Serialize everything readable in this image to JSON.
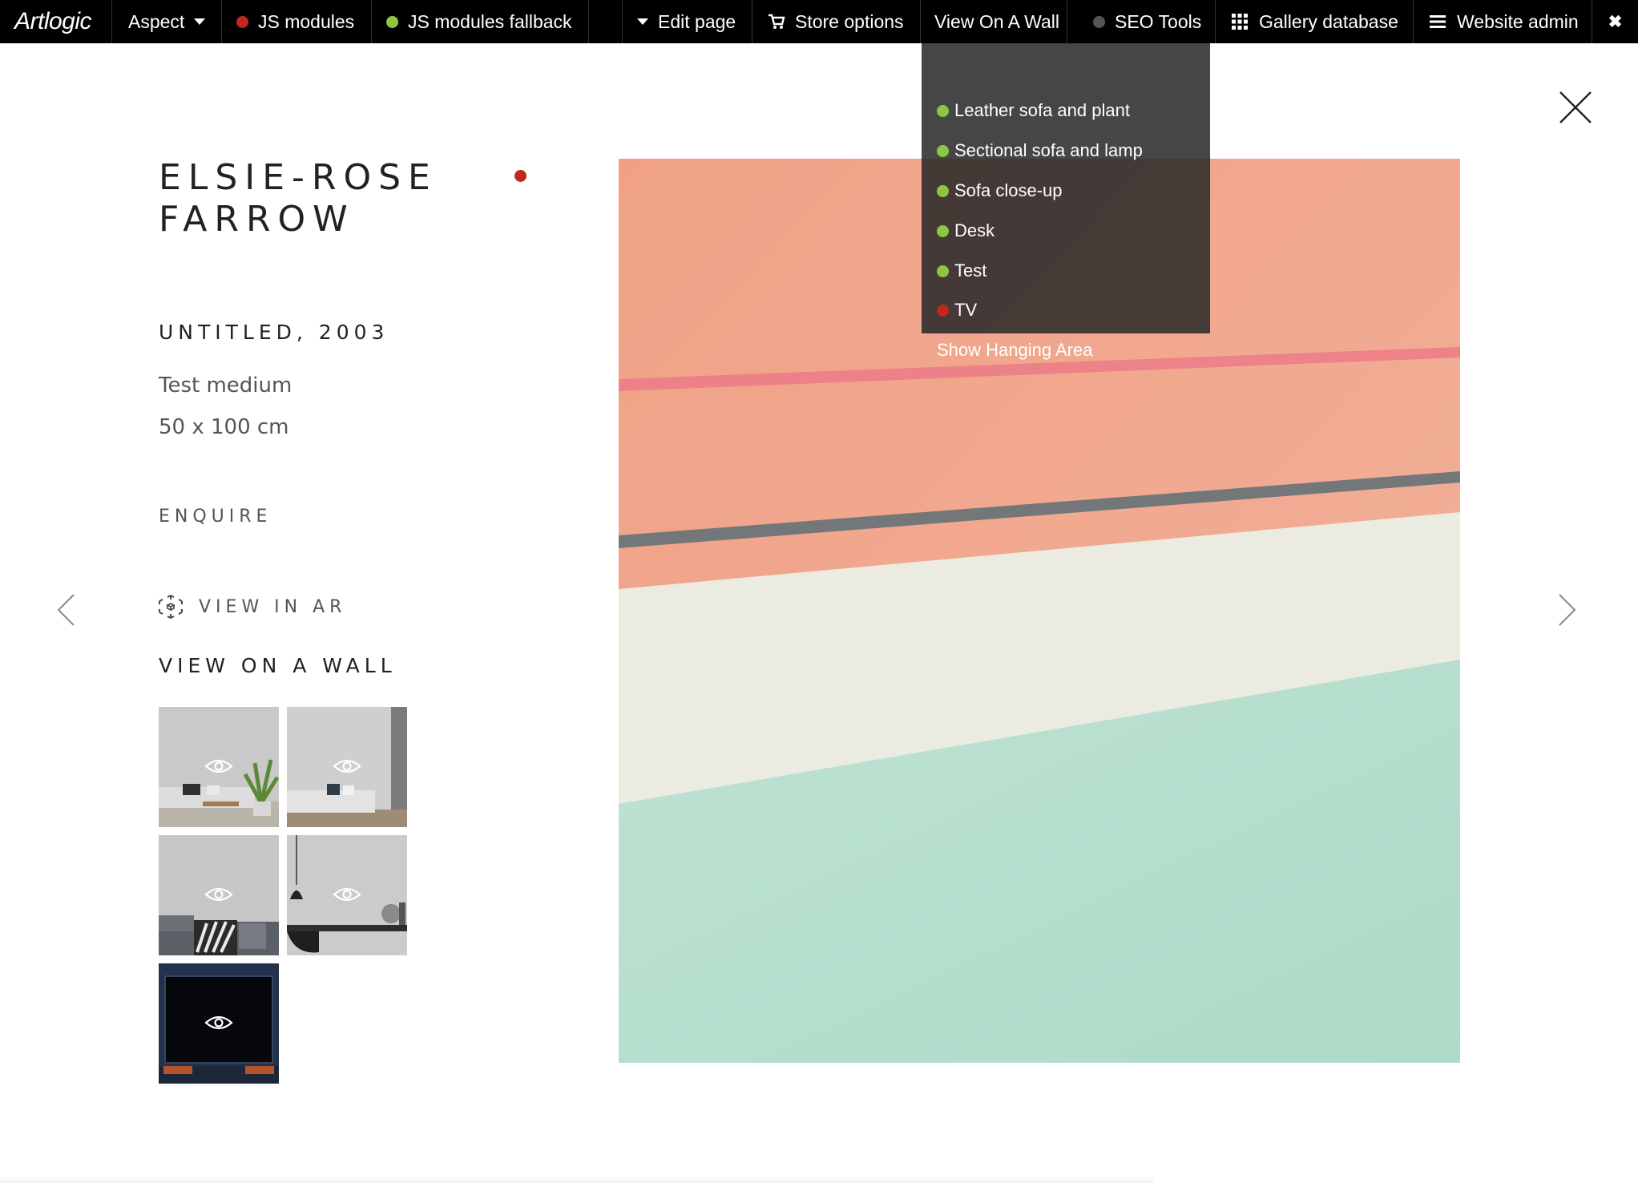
{
  "topbar": {
    "logo": "Artlogic",
    "items": [
      {
        "label": "Aspect",
        "icon": "caret-down-icon"
      },
      {
        "label": "JS modules",
        "status_color": "#c0281e"
      },
      {
        "label": "JS modules fallback",
        "status_color": "#8dc63f"
      },
      {
        "label": "Edit page",
        "icon": "caret-down-icon"
      },
      {
        "label": "Store options",
        "icon": "cart-icon"
      },
      {
        "label": "View On A Wall"
      },
      {
        "label": "SEO Tools",
        "status_color": "#555555"
      },
      {
        "label": "Gallery database",
        "icon": "grid-icon"
      },
      {
        "label": "Website admin",
        "icon": "hamburger-icon"
      },
      {
        "label": "✖",
        "icon": "close-icon"
      }
    ]
  },
  "wall_dropdown": {
    "items": [
      {
        "label": "Leather sofa and plant",
        "status_color": "#8dc63f"
      },
      {
        "label": "Sectional sofa and lamp",
        "status_color": "#8dc63f"
      },
      {
        "label": "Sofa close-up",
        "status_color": "#8dc63f"
      },
      {
        "label": "Desk",
        "status_color": "#8dc63f"
      },
      {
        "label": "Test",
        "status_color": "#8dc63f"
      },
      {
        "label": "TV",
        "status_color": "#c0281e"
      },
      {
        "label": "Show Hanging Area"
      }
    ]
  },
  "artwork": {
    "artist_line1": "ELSIE-ROSE",
    "artist_line2": "FARROW",
    "status_color": "#c0281e",
    "title": "UNTITLED, 2003",
    "medium": "Test medium",
    "size": "50 x 100 cm",
    "enquire": "ENQUIRE",
    "view_in_ar": "VIEW IN AR",
    "view_on_wall_heading": "VIEW ON A WALL",
    "image_colors": {
      "salmon": "#eea68a",
      "cream": "#ecebe2",
      "mint": "#b4ddcb",
      "pink_line": "#ec7d87",
      "grey_line": "#6b7478"
    }
  },
  "wall_thumbnails": [
    {
      "name": "leather-sofa-and-plant",
      "icon": "eye-icon"
    },
    {
      "name": "sectional-sofa-and-lamp",
      "icon": "eye-icon"
    },
    {
      "name": "sofa-close-up",
      "icon": "eye-icon"
    },
    {
      "name": "desk",
      "icon": "eye-icon"
    },
    {
      "name": "tv",
      "icon": "eye-icon"
    }
  ]
}
